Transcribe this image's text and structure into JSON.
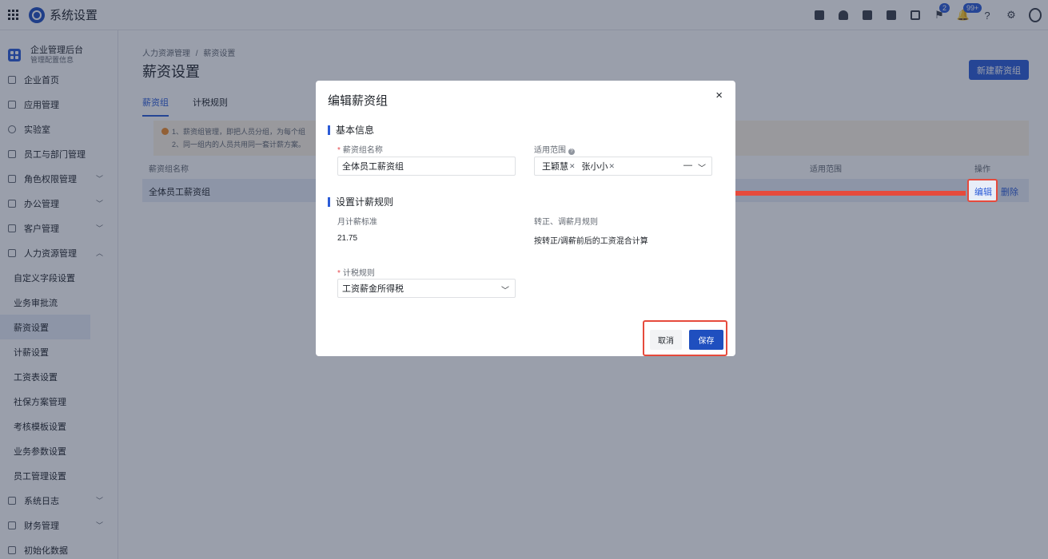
{
  "topbar": {
    "app_title": "系统设置",
    "icons": [
      "calendar-check-icon",
      "contact-icon",
      "document-icon",
      "phone-book-icon",
      "calendar-icon",
      "flag-icon",
      "bell-icon",
      "help-icon",
      "gear-icon",
      "user-avatar-icon"
    ],
    "flag_badge": "2",
    "bell_badge": "99+"
  },
  "sidebar": {
    "org_name": "企业管理后台",
    "org_sub": "管理配置信息",
    "items": [
      {
        "label": "企业首页",
        "icon": "home-icon"
      },
      {
        "label": "应用管理",
        "icon": "apps-icon"
      },
      {
        "label": "实验室",
        "icon": "bulb-icon"
      },
      {
        "label": "员工与部门管理",
        "icon": "team-icon"
      },
      {
        "label": "角色权限管理",
        "icon": "role-icon",
        "expandable": true
      },
      {
        "label": "办公管理",
        "icon": "office-icon",
        "expandable": true
      },
      {
        "label": "客户管理",
        "icon": "customer-icon",
        "expandable": true
      },
      {
        "label": "人力资源管理",
        "icon": "hr-icon",
        "expanded": true
      }
    ],
    "hr_sub_items": [
      "自定义字段设置",
      "业务审批流",
      "薪资设置",
      "计薪设置",
      "工资表设置",
      "社保方案管理",
      "考核模板设置",
      "业务参数设置",
      "员工管理设置"
    ],
    "bottom_items": [
      {
        "label": "系统日志",
        "icon": "log-icon"
      },
      {
        "label": "财务管理",
        "icon": "finance-icon"
      },
      {
        "label": "初始化数据",
        "icon": "init-icon"
      }
    ]
  },
  "main": {
    "breadcrumb": [
      "人力资源管理",
      "/",
      "薪资设置"
    ],
    "title": "薪资设置",
    "new_button": "新建薪资组",
    "tabs": [
      "薪资组",
      "计税规则"
    ],
    "tip_line1": "1、薪资组管理，即把人员分组，为每个组",
    "tip_line2": "2、同一组内的人员共用同一套计薪方案。",
    "table": {
      "headers": {
        "name": "薪资组名称",
        "scope": "适用范围",
        "actions": "操作"
      },
      "row": {
        "name": "全体员工薪资组",
        "edit": "编辑",
        "delete": "删除"
      }
    }
  },
  "modal": {
    "title": "编辑薪资组",
    "close": "×",
    "section_basic": "基本信息",
    "group_name_label": "薪资组名称",
    "group_name_value": "全体员工薪资组",
    "scope_label": "适用范围",
    "scope_tags": [
      "王颖慧",
      "张小小"
    ],
    "section_rules": "设置计薪规则",
    "monthly_label": "月计薪标准",
    "monthly_value": "21.75",
    "adjust_label": "转正、调薪月规则",
    "adjust_value": "按转正/调薪前后的工资混合计算",
    "tax_label": "计税规则",
    "tax_value": "工资薪金所得税",
    "cancel": "取消",
    "save": "保存"
  },
  "colors": {
    "primary": "#2b5bd7",
    "highlight": "#e64a3c",
    "overlay": "rgba(31,42,68,0.45)"
  }
}
